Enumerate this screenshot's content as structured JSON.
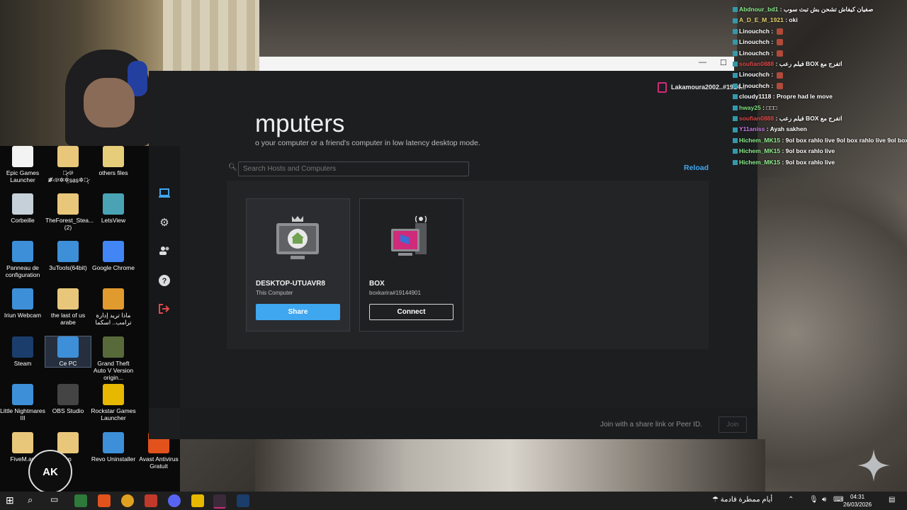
{
  "parsec": {
    "account_name": "Lakamoura2002..#1914...",
    "page_title": "mputers",
    "page_subtitle": "o your computer or a friend's computer in low latency desktop mode.",
    "search_placeholder": "Search Hosts and Computers",
    "reload_label": "Reload",
    "computers": [
      {
        "name": "DESKTOP-UTUAVR8",
        "subtitle": "This Computer",
        "action": "Share"
      },
      {
        "name": "BOX",
        "subtitle": "boxkarira#19144901",
        "action": "Connect"
      }
    ],
    "join_hint": "Join with a share link or Peer ID.",
    "join_label": "Join",
    "accent_color": "#3fa6f0",
    "brand_color": "#d02a7a"
  },
  "window_controls": {
    "minimize": "—",
    "maximize": "☐"
  },
  "desktop_icons": [
    {
      "label": "Epic Games Launcher"
    },
    {
      "label": "ঞ̷̨ঞ\n✲̸̸ঞ✲✲̤s̤a̤s̤✲ঞ̷̨"
    },
    {
      "label": "others files"
    },
    {
      "label": "Corbeille"
    },
    {
      "label": "TheForest_Stea...(2)"
    },
    {
      "label": "LetsView"
    },
    {
      "label": "Panneau de configuration"
    },
    {
      "label": "3uTools(64bit)"
    },
    {
      "label": "Google Chrome"
    },
    {
      "label": "Iriun Webcam"
    },
    {
      "label": "the last of us arabe"
    },
    {
      "label": "ماذا تريد إدارة ترامب.. اسكما"
    },
    {
      "label": "Steam"
    },
    {
      "label": "Ce PC"
    },
    {
      "label": "Grand Theft Auto V Version origin..."
    },
    {
      "label": "Little Nightmares III"
    },
    {
      "label": "OBS Studio"
    },
    {
      "label": "Rockstar Games Launcher"
    },
    {
      "label": "FiveM.ap"
    },
    {
      "label": "up"
    },
    {
      "label": "Revo Uninstaller"
    },
    {
      "label": "Avast Antivirus Gratuit"
    }
  ],
  "chat": [
    {
      "user": "Abdnour_bd1",
      "text": "صفيان كيفاش تشحن بش تبث سوب",
      "color": "#8ef08e"
    },
    {
      "user": "A_D_E_M_1921",
      "text": "oki",
      "color": "#e9d36a"
    },
    {
      "user": "Linouchch",
      "text": "",
      "color": "#fff"
    },
    {
      "user": "Linouchch",
      "text": "",
      "color": "#fff"
    },
    {
      "user": "Linouchch",
      "text": "",
      "color": "#fff"
    },
    {
      "user": "soufian0888",
      "text": "فيلم رعب BOX اتفرج مع",
      "color": "#e04a4a"
    },
    {
      "user": "Linouchch",
      "text": "",
      "color": "#fff"
    },
    {
      "user": "Linouchch",
      "text": "",
      "color": "#fff"
    },
    {
      "user": "cloudy1118",
      "text": "Propre had le move",
      "color": "#fff"
    },
    {
      "user": "hway25",
      "text": "□□□",
      "color": "#7fe07f"
    },
    {
      "user": "soufian0888",
      "text": "فيلم رعب BOX اتفرج مع",
      "color": "#e04a4a"
    },
    {
      "user": "Y11aniss",
      "text": "Ayah sakhen",
      "color": "#c77be8"
    },
    {
      "user": "Hichem_MK15",
      "text": "9ol box rahlo live 9ol box rahlo live 9ol box rahlo",
      "color": "#8ef08e"
    },
    {
      "user": "Hichem_MK15",
      "text": "9ol box rahlo live",
      "color": "#8ef08e"
    },
    {
      "user": "Hichem_MK15",
      "text": "9ol box rahlo live",
      "color": "#8ef08e"
    }
  ],
  "taskbar": {
    "weather_text": "أيام ممطرة قادمة",
    "time": "04:31",
    "date": "26/03/2026"
  },
  "ak_logo_text": "AK"
}
